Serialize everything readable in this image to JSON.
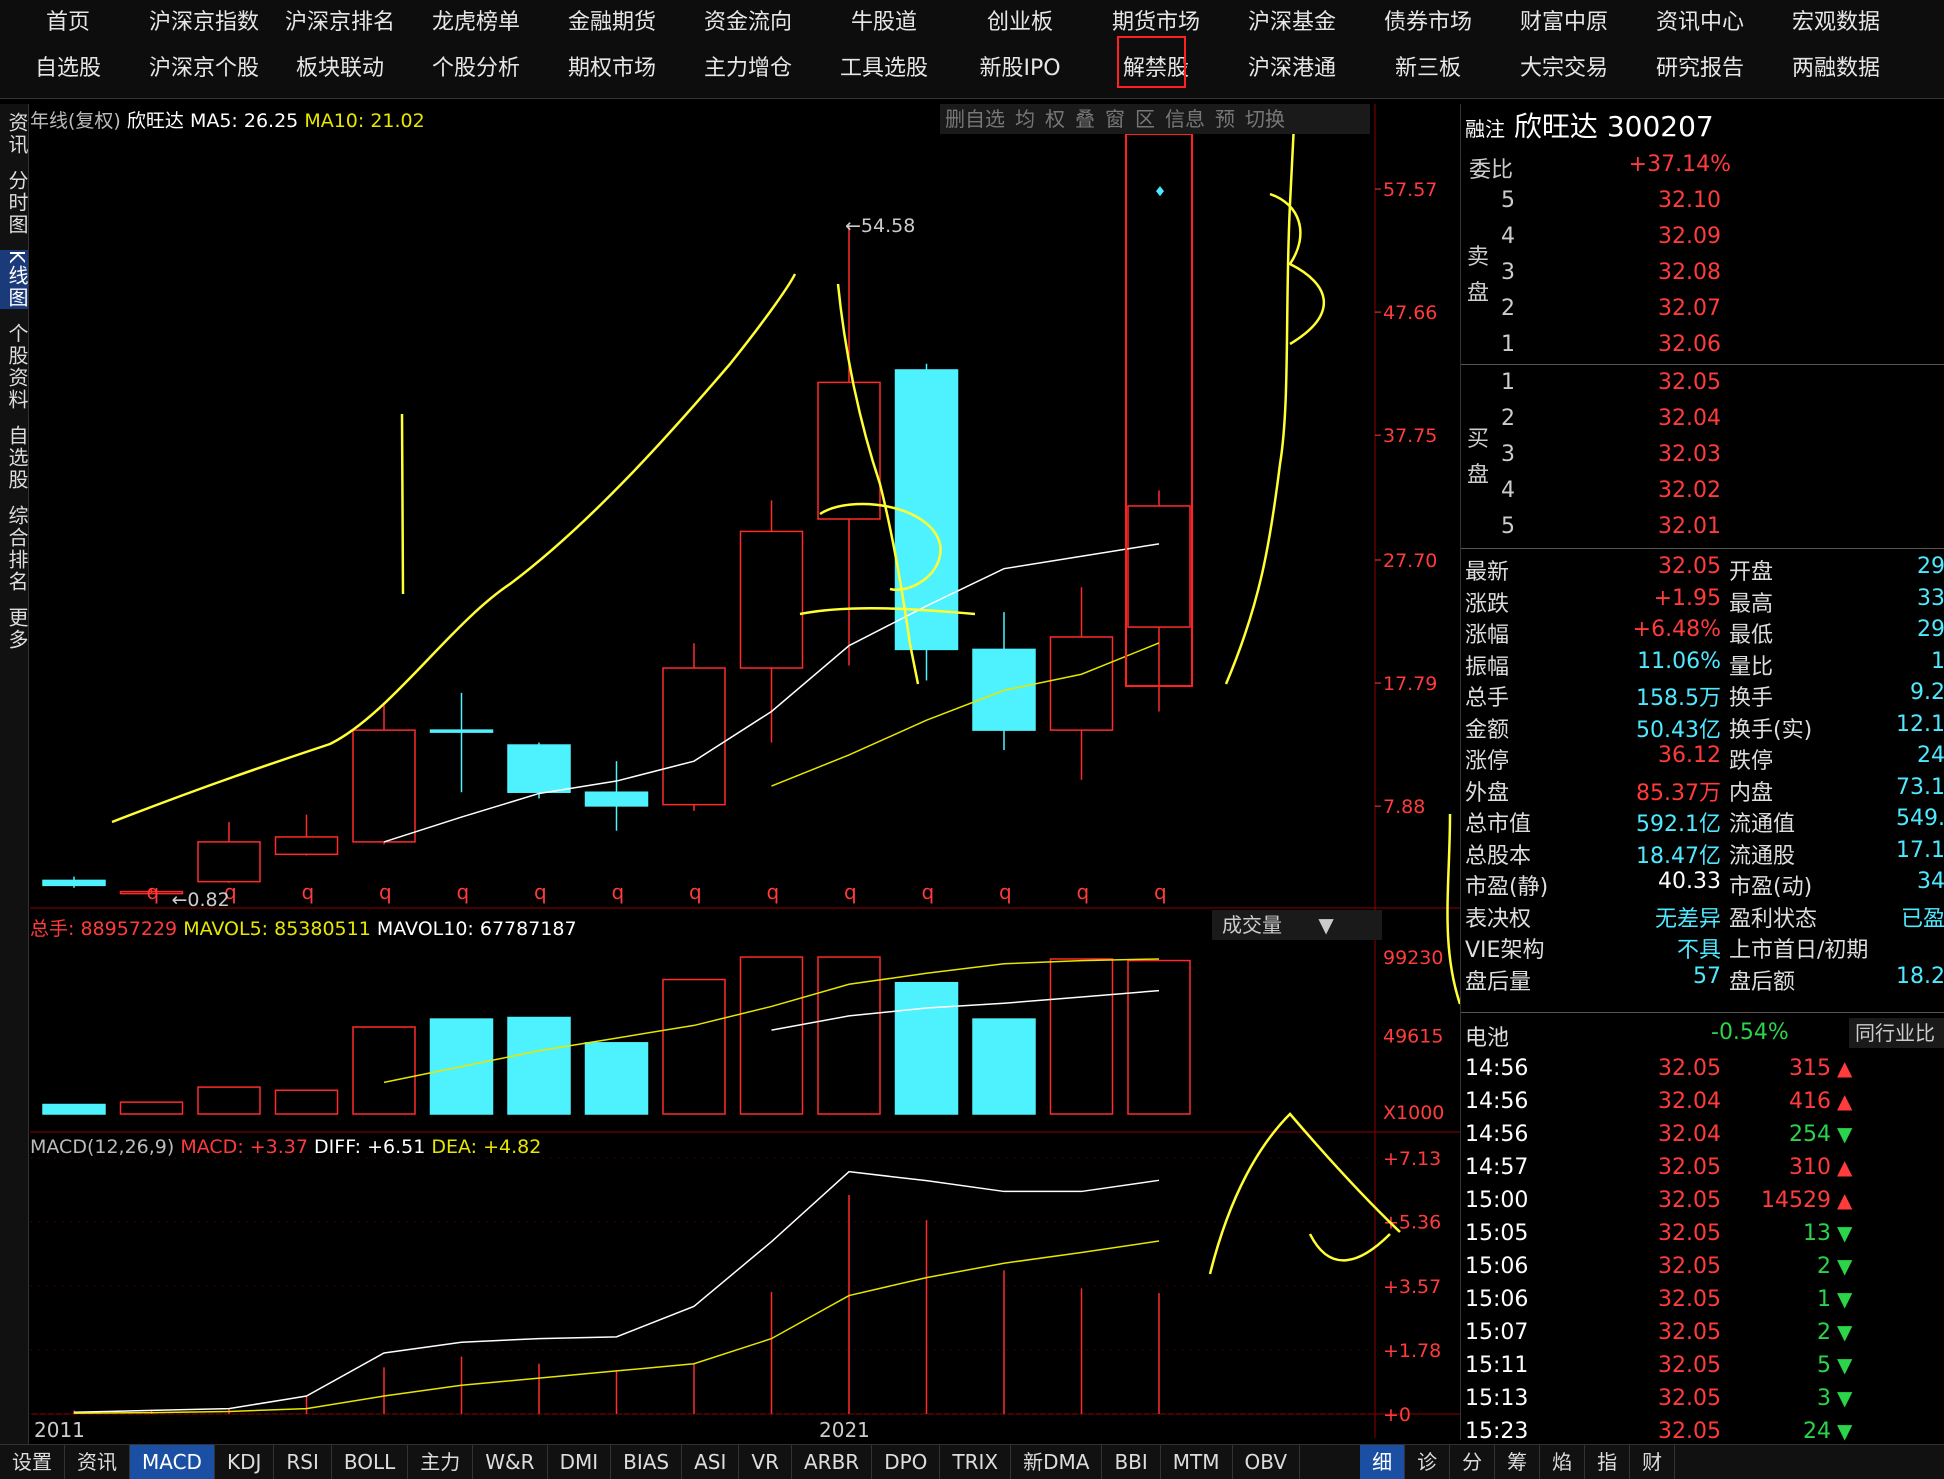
{
  "nav": {
    "row1": [
      "首页",
      "沪深京指数",
      "沪深京排名",
      "龙虎榜单",
      "金融期货",
      "资金流向",
      "牛股道",
      "创业板",
      "期货市场",
      "沪深基金",
      "债券市场",
      "财富中原",
      "资讯中心",
      "宏观数据"
    ],
    "row2": [
      "自选股",
      "沪深京个股",
      "板块联动",
      "个股分析",
      "期权市场",
      "主力增仓",
      "工具选股",
      "新股IPO",
      "解禁股",
      "沪深港通",
      "新三板",
      "大宗交易",
      "研究报告",
      "两融数据"
    ]
  },
  "sidebar": [
    "资讯",
    "分时图",
    "K线图",
    "个股资料",
    "自选股",
    "综合排名",
    "更多"
  ],
  "chart": {
    "header": {
      "period": "年线(复权)",
      "name": "欣旺达",
      "ma5_label": "MA5: 26.25",
      "ma10_label": "MA10: 21.02"
    },
    "toolbar": [
      "删自选",
      "均",
      "权",
      "叠",
      "窗",
      "区",
      "信息",
      "预",
      "切换"
    ],
    "price_axis": [
      "57.57",
      "47.66",
      "37.75",
      "27.70",
      "17.79",
      "7.88"
    ],
    "annot_high": "54.58",
    "annot_low": "0.82",
    "q_marks": [
      "q",
      "q",
      "q",
      "q",
      "q",
      "q",
      "q",
      "q",
      "q",
      "q",
      "q",
      "q",
      "q",
      "q"
    ],
    "volume": {
      "label": "总手: 88957229",
      "mavol5": "MAVOL5: 85380511",
      "mavol10": "MAVOL10: 67787187",
      "selector": "成交量",
      "axis": [
        "99230",
        "49615",
        "X1000"
      ]
    },
    "macd": {
      "label": "MACD(12,26,9)",
      "macd": "MACD: +3.37",
      "diff": "DIFF: +6.51",
      "dea": "DEA: +4.82",
      "axis": [
        "+7.13",
        "+5.36",
        "+3.57",
        "+1.78",
        "+0"
      ]
    },
    "x_labels": [
      "2011",
      "2021"
    ]
  },
  "chart_data": {
    "type": "candlestick",
    "candles": [
      {
        "o": 1.5,
        "c": 1.9,
        "h": 2.2,
        "l": 1.3,
        "up": false
      },
      {
        "o": 0.95,
        "c": 1.0,
        "h": 1.2,
        "l": 0.82,
        "up": true
      },
      {
        "o": 1.8,
        "c": 5.0,
        "h": 6.6,
        "l": 1.7,
        "up": true
      },
      {
        "o": 4.0,
        "c": 5.4,
        "h": 7.2,
        "l": 3.9,
        "up": true
      },
      {
        "o": 5.0,
        "c": 14.0,
        "h": 16.0,
        "l": 4.8,
        "up": true
      },
      {
        "o": 14.0,
        "c": 14.0,
        "h": 17.0,
        "l": 9.0,
        "up": false
      },
      {
        "o": 12.8,
        "c": 9.0,
        "h": 13.0,
        "l": 8.5,
        "up": false
      },
      {
        "o": 9.0,
        "c": 7.9,
        "h": 11.5,
        "l": 5.9,
        "up": false
      },
      {
        "o": 8.0,
        "c": 19.0,
        "h": 21.0,
        "l": 7.5,
        "up": true
      },
      {
        "o": 19.0,
        "c": 30.0,
        "h": 32.5,
        "l": 13.0,
        "up": true
      },
      {
        "o": 31.0,
        "c": 42.0,
        "h": 54.58,
        "l": 19.2,
        "up": true
      },
      {
        "o": 43.0,
        "c": 20.5,
        "h": 43.5,
        "l": 18.0,
        "up": false
      },
      {
        "o": 20.5,
        "c": 14.0,
        "h": 23.5,
        "l": 12.4,
        "up": false
      },
      {
        "o": 14.0,
        "c": 21.5,
        "h": 25.5,
        "l": 10.0,
        "up": true
      },
      {
        "o": 22.3,
        "c": 32.05,
        "h": 33.3,
        "l": 15.5,
        "up": true
      }
    ],
    "ma5": [
      null,
      null,
      null,
      null,
      5.0,
      7.0,
      8.9,
      9.9,
      11.5,
      15.5,
      20.8,
      24.0,
      27.0,
      28.0,
      29.0
    ],
    "ma10": [
      null,
      null,
      null,
      null,
      null,
      null,
      null,
      null,
      null,
      9.5,
      12.0,
      14.8,
      17.2,
      18.5,
      21.02
    ],
    "volume": [
      6000,
      7500,
      17000,
      15000,
      55000,
      60000,
      61000,
      45000,
      85000,
      99230,
      99230,
      83000,
      60000,
      98000,
      97000
    ],
    "mavol5": [
      null,
      null,
      null,
      null,
      20000,
      30000,
      40000,
      48000,
      56000,
      68000,
      82000,
      89000,
      95000,
      97000,
      98000
    ],
    "mavol10": [
      null,
      null,
      null,
      null,
      null,
      null,
      null,
      null,
      null,
      53000,
      62000,
      67000,
      70000,
      74000,
      78000
    ],
    "diff": [
      0.05,
      0.1,
      0.15,
      0.5,
      1.7,
      2.0,
      2.1,
      2.15,
      3.0,
      4.8,
      6.75,
      6.5,
      6.2,
      6.2,
      6.51
    ],
    "dea": [
      0.02,
      0.04,
      0.07,
      0.15,
      0.5,
      0.8,
      1.0,
      1.2,
      1.4,
      2.1,
      3.3,
      3.8,
      4.2,
      4.5,
      4.82
    ],
    "macd_bar": [
      0.1,
      0.1,
      0.15,
      0.5,
      1.3,
      1.6,
      1.4,
      1.2,
      1.4,
      3.4,
      6.1,
      5.4,
      4.0,
      3.5,
      3.37
    ],
    "price_range": [
      0,
      62.0
    ],
    "volume_range": [
      0,
      110000
    ],
    "macd_range": [
      0,
      7.8
    ]
  },
  "quote": {
    "title_prefix": "融注",
    "name": "欣旺达",
    "code": "300207",
    "ratio_label": "委比",
    "ratio_value": "+37.14%",
    "sell_label": "卖盘",
    "buy_label": "买盘",
    "sells": [
      {
        "lvl": "5",
        "p": "32.10"
      },
      {
        "lvl": "4",
        "p": "32.09"
      },
      {
        "lvl": "3",
        "p": "32.08"
      },
      {
        "lvl": "2",
        "p": "32.07"
      },
      {
        "lvl": "1",
        "p": "32.06"
      }
    ],
    "buys": [
      {
        "lvl": "1",
        "p": "32.05"
      },
      {
        "lvl": "2",
        "p": "32.04"
      },
      {
        "lvl": "3",
        "p": "32.03"
      },
      {
        "lvl": "4",
        "p": "32.02"
      },
      {
        "lvl": "5",
        "p": "32.01"
      }
    ],
    "stats": [
      {
        "k1": "最新",
        "v1": "32.05",
        "c1": "red",
        "k2": "开盘",
        "v2": "29"
      },
      {
        "k1": "涨跌",
        "v1": "+1.95",
        "c1": "red",
        "k2": "最高",
        "v2": "33"
      },
      {
        "k1": "涨幅",
        "v1": "+6.48%",
        "c1": "red",
        "k2": "最低",
        "v2": "29"
      },
      {
        "k1": "振幅",
        "v1": "11.06%",
        "c1": "cyan",
        "k2": "量比",
        "v2": "1"
      },
      {
        "k1": "总手",
        "v1": "158.5万",
        "c1": "cyan",
        "k2": "换手",
        "v2": "9.2"
      },
      {
        "k1": "金额",
        "v1": "50.43亿",
        "c1": "cyan",
        "k2": "换手(实)",
        "v2": "12.1"
      },
      {
        "k1": "涨停",
        "v1": "36.12",
        "c1": "red",
        "k2": "跌停",
        "v2": "24"
      },
      {
        "k1": "外盘",
        "v1": "85.37万",
        "c1": "red",
        "k2": "内盘",
        "v2": "73.1"
      },
      {
        "k1": "总市值",
        "v1": "592.1亿",
        "c1": "cyan",
        "k2": "流通值",
        "v2": "549."
      },
      {
        "k1": "总股本",
        "v1": "18.47亿",
        "c1": "cyan",
        "k2": "流通股",
        "v2": "17.1"
      },
      {
        "k1": "市盈(静)",
        "v1": "40.33",
        "c1": "white",
        "k2": "市盈(动)",
        "v2": "34"
      },
      {
        "k1": "表决权",
        "v1": "无差异",
        "c1": "cyan",
        "k2": "盈利状态",
        "v2": "已盈"
      },
      {
        "k1": "VIE架构",
        "v1": "不具",
        "c1": "cyan",
        "k2": "上市首日/初期",
        "v2": ""
      },
      {
        "k1": "盘后量",
        "v1": "57",
        "c1": "cyan",
        "k2": "盘后额",
        "v2": "18.2"
      }
    ],
    "battery_label": "电池",
    "battery_value": "-0.54%",
    "compare_btn": "同行业比",
    "ticks": [
      {
        "t": "14:56",
        "p": "32.05",
        "v": "315",
        "d": "up"
      },
      {
        "t": "14:56",
        "p": "32.04",
        "v": "416",
        "d": "up"
      },
      {
        "t": "14:56",
        "p": "32.04",
        "v": "254",
        "d": "down"
      },
      {
        "t": "14:57",
        "p": "32.05",
        "v": "310",
        "d": "up"
      },
      {
        "t": "15:00",
        "p": "32.05",
        "v": "14529",
        "d": "up"
      },
      {
        "t": "15:05",
        "p": "32.05",
        "v": "13",
        "d": "down"
      },
      {
        "t": "15:06",
        "p": "32.05",
        "v": "2",
        "d": "down"
      },
      {
        "t": "15:06",
        "p": "32.05",
        "v": "1",
        "d": "down"
      },
      {
        "t": "15:07",
        "p": "32.05",
        "v": "2",
        "d": "down"
      },
      {
        "t": "15:11",
        "p": "32.05",
        "v": "5",
        "d": "down"
      },
      {
        "t": "15:13",
        "p": "32.05",
        "v": "3",
        "d": "down"
      },
      {
        "t": "15:23",
        "p": "32.05",
        "v": "24",
        "d": "down"
      }
    ]
  },
  "bottombar": [
    "设置",
    "资讯",
    "MACD",
    "KDJ",
    "RSI",
    "BOLL",
    "主力",
    "W&R",
    "DMI",
    "BIAS",
    "ASI",
    "VR",
    "ARBR",
    "DPO",
    "TRIX",
    "新DMA",
    "BBI",
    "MTM",
    "OBV"
  ],
  "rightbar": [
    "细",
    "诊",
    "分",
    "筹",
    "焰",
    "指",
    "财"
  ],
  "colors": {
    "up": "#ff2a2a",
    "down": "#4ef2ff",
    "ma5": "#ffffff",
    "ma10": "#e6e600",
    "annotation": "#ffff33"
  }
}
